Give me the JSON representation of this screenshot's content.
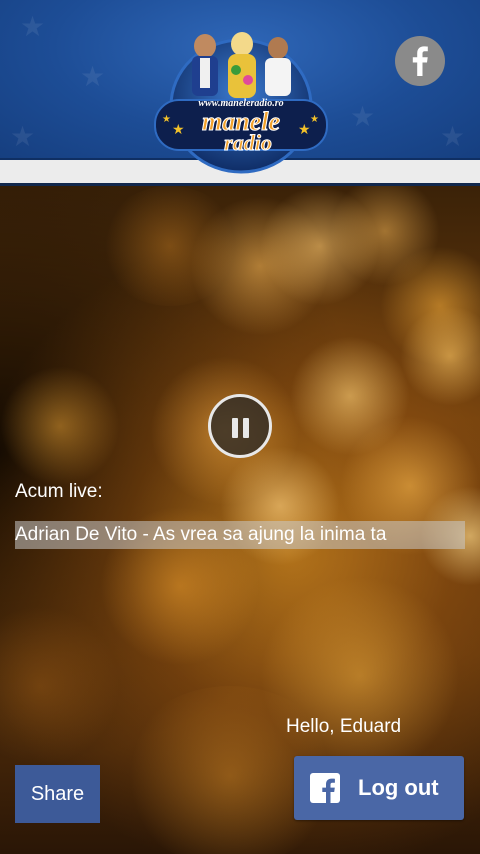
{
  "header": {
    "logo_url_text": "www.maneleradio.ro",
    "logo_word1": "manele",
    "logo_word2": "radio",
    "facebook_icon": "facebook-icon"
  },
  "player": {
    "control_icon": "pause-icon",
    "live_label": "Acum live:",
    "track_title": "Adrian De Vito - As vrea sa ajung la inima ta"
  },
  "user": {
    "greeting": "Hello, Eduard"
  },
  "actions": {
    "share_label": "Share",
    "logout_label": "Log out",
    "logout_icon": "facebook-icon"
  },
  "colors": {
    "header_blue": "#1d4d96",
    "facebook_blue": "#3d5a98",
    "logout_blue": "#4a67a6"
  }
}
